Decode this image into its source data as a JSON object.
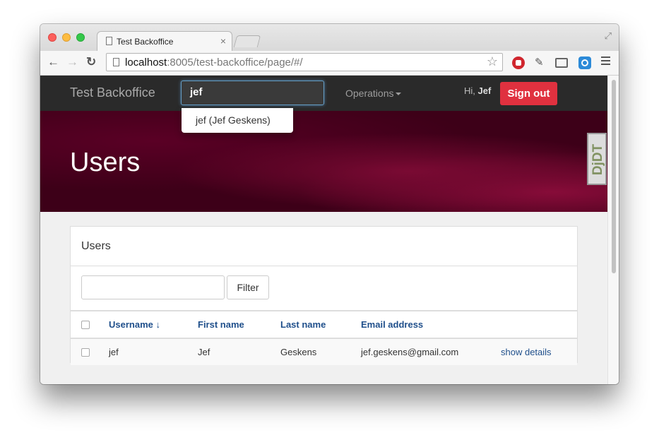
{
  "browser": {
    "tab_title": "Test Backoffice",
    "url_host": "localhost",
    "url_rest": ":8005/test-backoffice/page/#/"
  },
  "navbar": {
    "brand": "Test Backoffice",
    "search_value": "jef",
    "operations_label": "Operations",
    "greeting": "Hi,",
    "user_name": "Jef",
    "signout_label": "Sign out"
  },
  "autocomplete": {
    "suggestion": "jef (Jef Geskens)"
  },
  "hero": {
    "title": "Users"
  },
  "debug_toolbar": {
    "label": "DjDT"
  },
  "panel": {
    "title": "Users",
    "filter_button": "Filter",
    "filter_value": "",
    "columns": [
      "Username ↓",
      "First name",
      "Last name",
      "Email address"
    ],
    "rows": [
      {
        "username": "jef",
        "first_name": "Jef",
        "last_name": "Geskens",
        "email": "jef.geskens@gmail.com",
        "action": "show details"
      }
    ]
  },
  "colors": {
    "navbar_bg": "#2a2a2a",
    "signout_bg": "#e0313f",
    "hero_bg": "#3d0018",
    "header_link": "#1f4f8b"
  }
}
